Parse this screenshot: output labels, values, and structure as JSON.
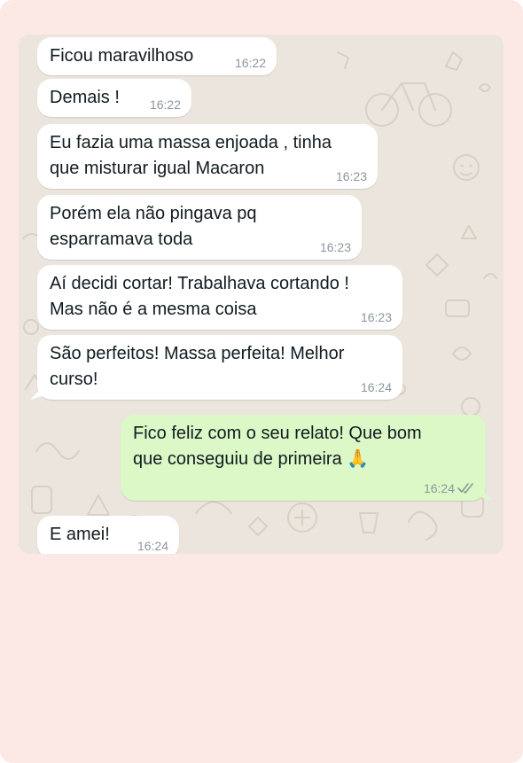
{
  "colors": {
    "page_background": "#fce8e4",
    "chat_wallpaper": "#ece5dd",
    "incoming_bubble": "#ffffff",
    "outgoing_bubble": "#dcf8c6",
    "timestamp_text": "#8c979d"
  },
  "messages": [
    {
      "direction": "incoming",
      "text": "Ficou maravilhoso",
      "time": "16:22"
    },
    {
      "direction": "incoming",
      "text": "Demais !",
      "time": "16:22"
    },
    {
      "direction": "incoming",
      "text": "Eu fazia uma massa enjoada , tinha\nque misturar igual Macaron",
      "time": "16:23"
    },
    {
      "direction": "incoming",
      "text": "Porém ela não pingava pq\nesparramava toda",
      "time": "16:23"
    },
    {
      "direction": "incoming",
      "text": "Aí decidi cortar! Trabalhava cortando !\nMas não é a mesma coisa",
      "time": "16:23"
    },
    {
      "direction": "incoming",
      "text": "São perfeitos! Massa perfeita! Melhor\ncurso!",
      "time": "16:24"
    },
    {
      "direction": "outgoing",
      "text": "Fico feliz com o seu relato! Que bom\nque conseguiu de primeira 🙏",
      "time": "16:24",
      "status_icon": "double-check-read-icon"
    },
    {
      "direction": "incoming",
      "text": "E amei!",
      "time": "16:24"
    }
  ]
}
